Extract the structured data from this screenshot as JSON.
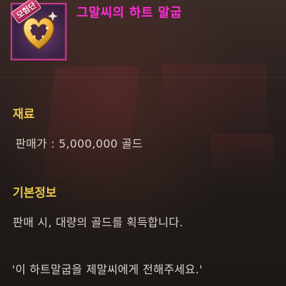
{
  "item": {
    "title": "그말씨의 하트 말굽",
    "badge": "모험단",
    "icon": "heart-horseshoe-icon",
    "title_color": "#ff2bd6",
    "frame_color": "#c23a8a"
  },
  "materials": {
    "heading": "재료",
    "sell_price": "판매가 : 5,000,000 골드"
  },
  "basic_info": {
    "heading": "기본정보",
    "description": "판매 시, 대량의 골드를 획득합니다."
  },
  "flavor_text": "'이 하트말굽을 제말씨에게 전해주세요.'",
  "colors": {
    "section_heading": "#e8c34a",
    "body_text": "#d8d2cc"
  }
}
